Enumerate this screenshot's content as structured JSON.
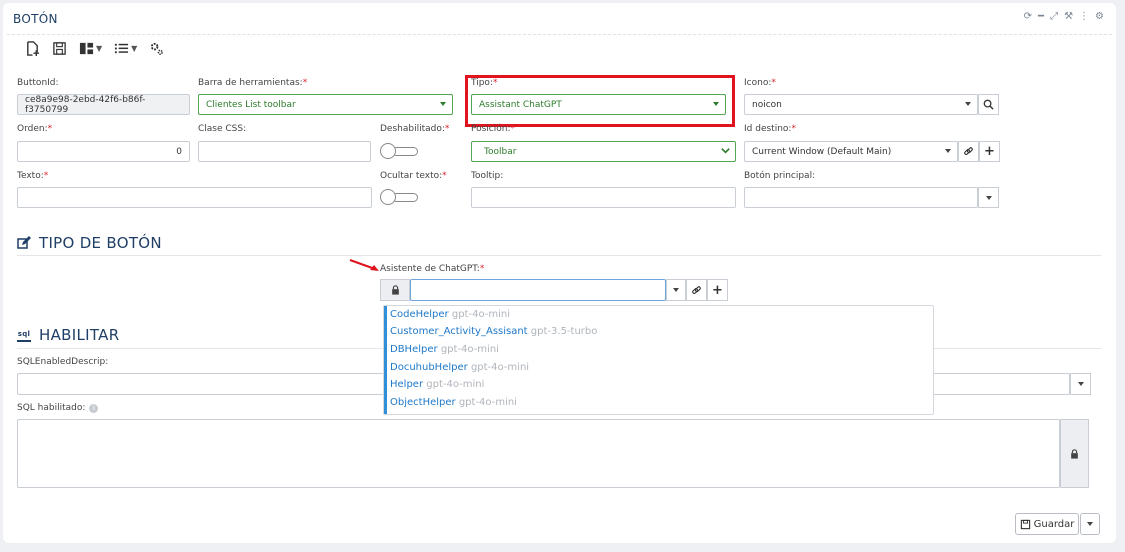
{
  "header": {
    "title": "BOTÓN",
    "controls": [
      "refresh-icon",
      "minimize-icon",
      "expand-icon",
      "tools-icon",
      "more-icon",
      "gear-icon"
    ]
  },
  "toolbar": {
    "icons": [
      "new-file-icon",
      "save-icon",
      "layout-icon",
      "list-icon",
      "settings-icon"
    ]
  },
  "fields": {
    "buttonid": {
      "label": "ButtonId:",
      "value": "ce8a9e98-2ebd-42f6-b86f-f3750799"
    },
    "barra": {
      "label": "Barra de herramientas:",
      "required": "*",
      "value": "Clientes List toolbar"
    },
    "tipo": {
      "label": "Tipo:",
      "required": "*",
      "value": "Assistant ChatGPT"
    },
    "icono": {
      "label": "Icono:",
      "required": "*",
      "value": "noicon"
    },
    "orden": {
      "label": "Orden:",
      "required": "*",
      "value": "0"
    },
    "clase": {
      "label": "Clase CSS:",
      "value": ""
    },
    "deshabilitado": {
      "label": "Deshabilitado:",
      "required": "*"
    },
    "posicion": {
      "label": "Posición:",
      "required": "*",
      "value": "Toolbar"
    },
    "destino": {
      "label": "Id destino:",
      "required": "*",
      "value": "Current Window (Default Main)"
    },
    "texto": {
      "label": "Texto:",
      "required": "*",
      "value": ""
    },
    "ocultar": {
      "label": "Ocultar texto:",
      "required": "*"
    },
    "tooltip": {
      "label": "Tooltip:",
      "value": ""
    },
    "principal": {
      "label": "Botón principal:",
      "value": ""
    }
  },
  "section_tipo": {
    "title": "TIPO DE BOTÓN"
  },
  "asistente": {
    "label": "Asistente de ChatGPT:",
    "required": "*",
    "value": ""
  },
  "assistants": [
    {
      "name": "CodeHelper",
      "model": "gpt-4o-mini"
    },
    {
      "name": "Customer_Activity_Assisant",
      "model": "gpt-3.5-turbo"
    },
    {
      "name": "DBHelper",
      "model": "gpt-4o-mini"
    },
    {
      "name": "DocuhubHelper",
      "model": "gpt-4o-mini"
    },
    {
      "name": "Helper",
      "model": "gpt-4o-mini"
    },
    {
      "name": "ObjectHelper",
      "model": "gpt-4o-mini"
    }
  ],
  "section_habilitar": {
    "title": "HABILITAR",
    "icon_text": "sql"
  },
  "sql_descrip": {
    "label": "SQLEnabledDescrip:",
    "value": ""
  },
  "sql_habilitado": {
    "label": "SQL habilitado:",
    "value": ""
  },
  "footer": {
    "save_label": "Guardar"
  },
  "colors": {
    "accent": "#1f3f66",
    "required": "#d9242e",
    "valid": "#52a552",
    "highlight": "#e0141e",
    "link": "#1e78c8"
  }
}
